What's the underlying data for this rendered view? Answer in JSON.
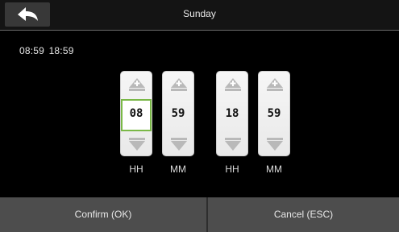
{
  "header": {
    "title": "Sunday",
    "back_icon": "back-arrow-icon"
  },
  "summary": {
    "text": "08:59  18:59"
  },
  "spinners": [
    {
      "value": "08",
      "unit": "HH",
      "selected": true
    },
    {
      "value": "59",
      "unit": "MM",
      "selected": false
    },
    {
      "value": "18",
      "unit": "HH",
      "selected": false
    },
    {
      "value": "59",
      "unit": "MM",
      "selected": false
    }
  ],
  "footer": {
    "confirm_label": "Confirm (OK)",
    "cancel_label": "Cancel (ESC)"
  },
  "colors": {
    "selection_border": "#7ab847",
    "footer_bg": "#4d4d4d",
    "header_bg": "#141414"
  }
}
